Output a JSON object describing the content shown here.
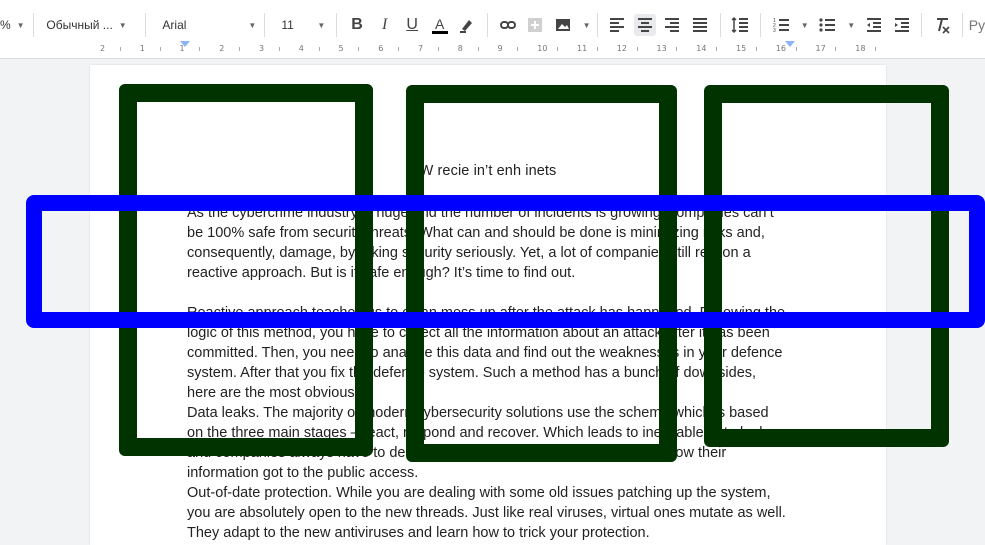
{
  "toolbar": {
    "zoom": "%",
    "style": "Обычный ...",
    "font": "Arial",
    "font_size": "11",
    "more_label": "Ру"
  },
  "ruler": {
    "labels": [
      "2",
      "1",
      "1",
      "2",
      "3",
      "4",
      "5",
      "6",
      "7",
      "8",
      "9",
      "10",
      "11",
      "12",
      "13",
      "14",
      "15",
      "16",
      "17",
      "18"
    ]
  },
  "document": {
    "title": "W recie in’t enh inets",
    "paragraphs": [
      "As the cybercrime industry is huge and the number of incidents is growing, companies can’t be 100% safe from security threats. What can and should be done is minimizing risks and, consequently, damage, by taking security seriously. Yet, a lot of companies still rely on a reactive approach. But is it safe enough? It’s time to find out.",
      "Reactive approach teaches us to clean mess up after the attack has happened. Following the logic of this method, you have to collect all the information about an attack after it has been committed. Then, you need to analyse this data and find out the weaknesses in your defence system. After that you fix the defence system. Such a method has a bunch of downsides, here are the most obvious:",
      "Data leaks. The majority of modern cybersecurity solutions use the scheme which is based on the three main stages – react, respond and recover. Which leads to inevitable data leaks, and companies always have to deal with angry customers trying to explain how their information got to the public access.",
      "Out-of-date protection. While you are dealing with some old issues patching up the system, you are absolutely open to the new threads. Just like real viruses, virtual ones mutate as well. They adapt to the new antiviruses and learn how to trick your protection."
    ]
  },
  "colors": {
    "overlay_green": "#003300",
    "overlay_blue": "#0000ff"
  }
}
